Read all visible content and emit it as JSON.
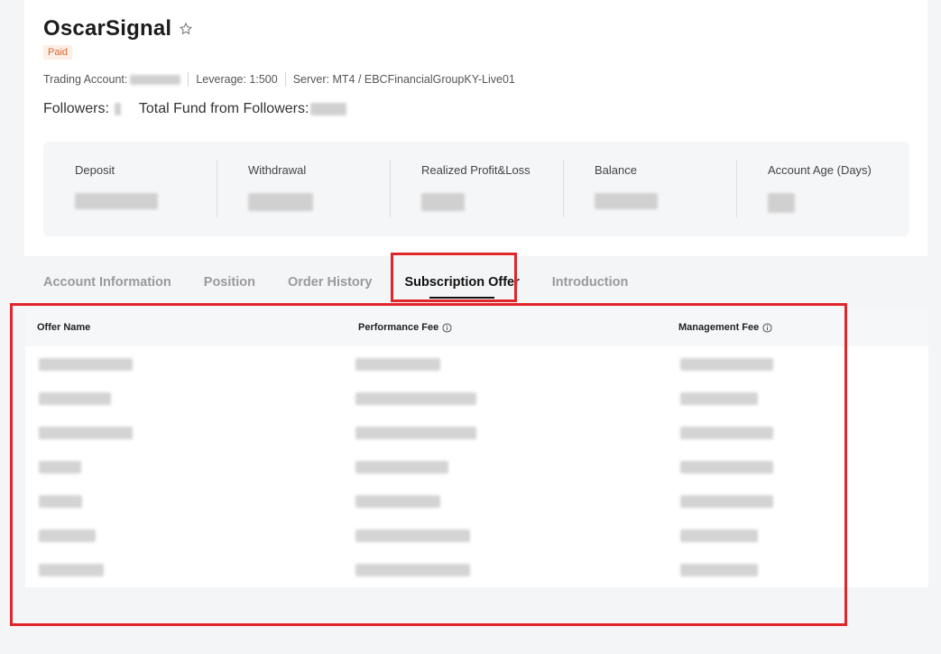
{
  "header": {
    "title": "OscarSignal",
    "badge": "Paid",
    "trading_account_label": "Trading Account:",
    "leverage": "Leverage: 1:500",
    "server": "Server: MT4 / EBCFinancialGroupKY-Live01",
    "followers_label": "Followers:",
    "total_fund_label": "Total Fund from Followers:"
  },
  "stats": [
    {
      "label": "Deposit"
    },
    {
      "label": "Withdrawal"
    },
    {
      "label": "Realized Profit&Loss"
    },
    {
      "label": "Balance"
    },
    {
      "label": "Account Age (Days)"
    }
  ],
  "tabs": [
    {
      "label": "Account Information"
    },
    {
      "label": "Position"
    },
    {
      "label": "Order History"
    },
    {
      "label": "Subscription Offer",
      "active": true
    },
    {
      "label": "Introduction"
    }
  ],
  "table": {
    "columns": [
      "Offer Name",
      "Performance Fee",
      "Management Fee"
    ]
  },
  "colors": {
    "highlight": "#e0262b",
    "badge_bg": "#fdeee6",
    "badge_text": "#d8662e"
  }
}
